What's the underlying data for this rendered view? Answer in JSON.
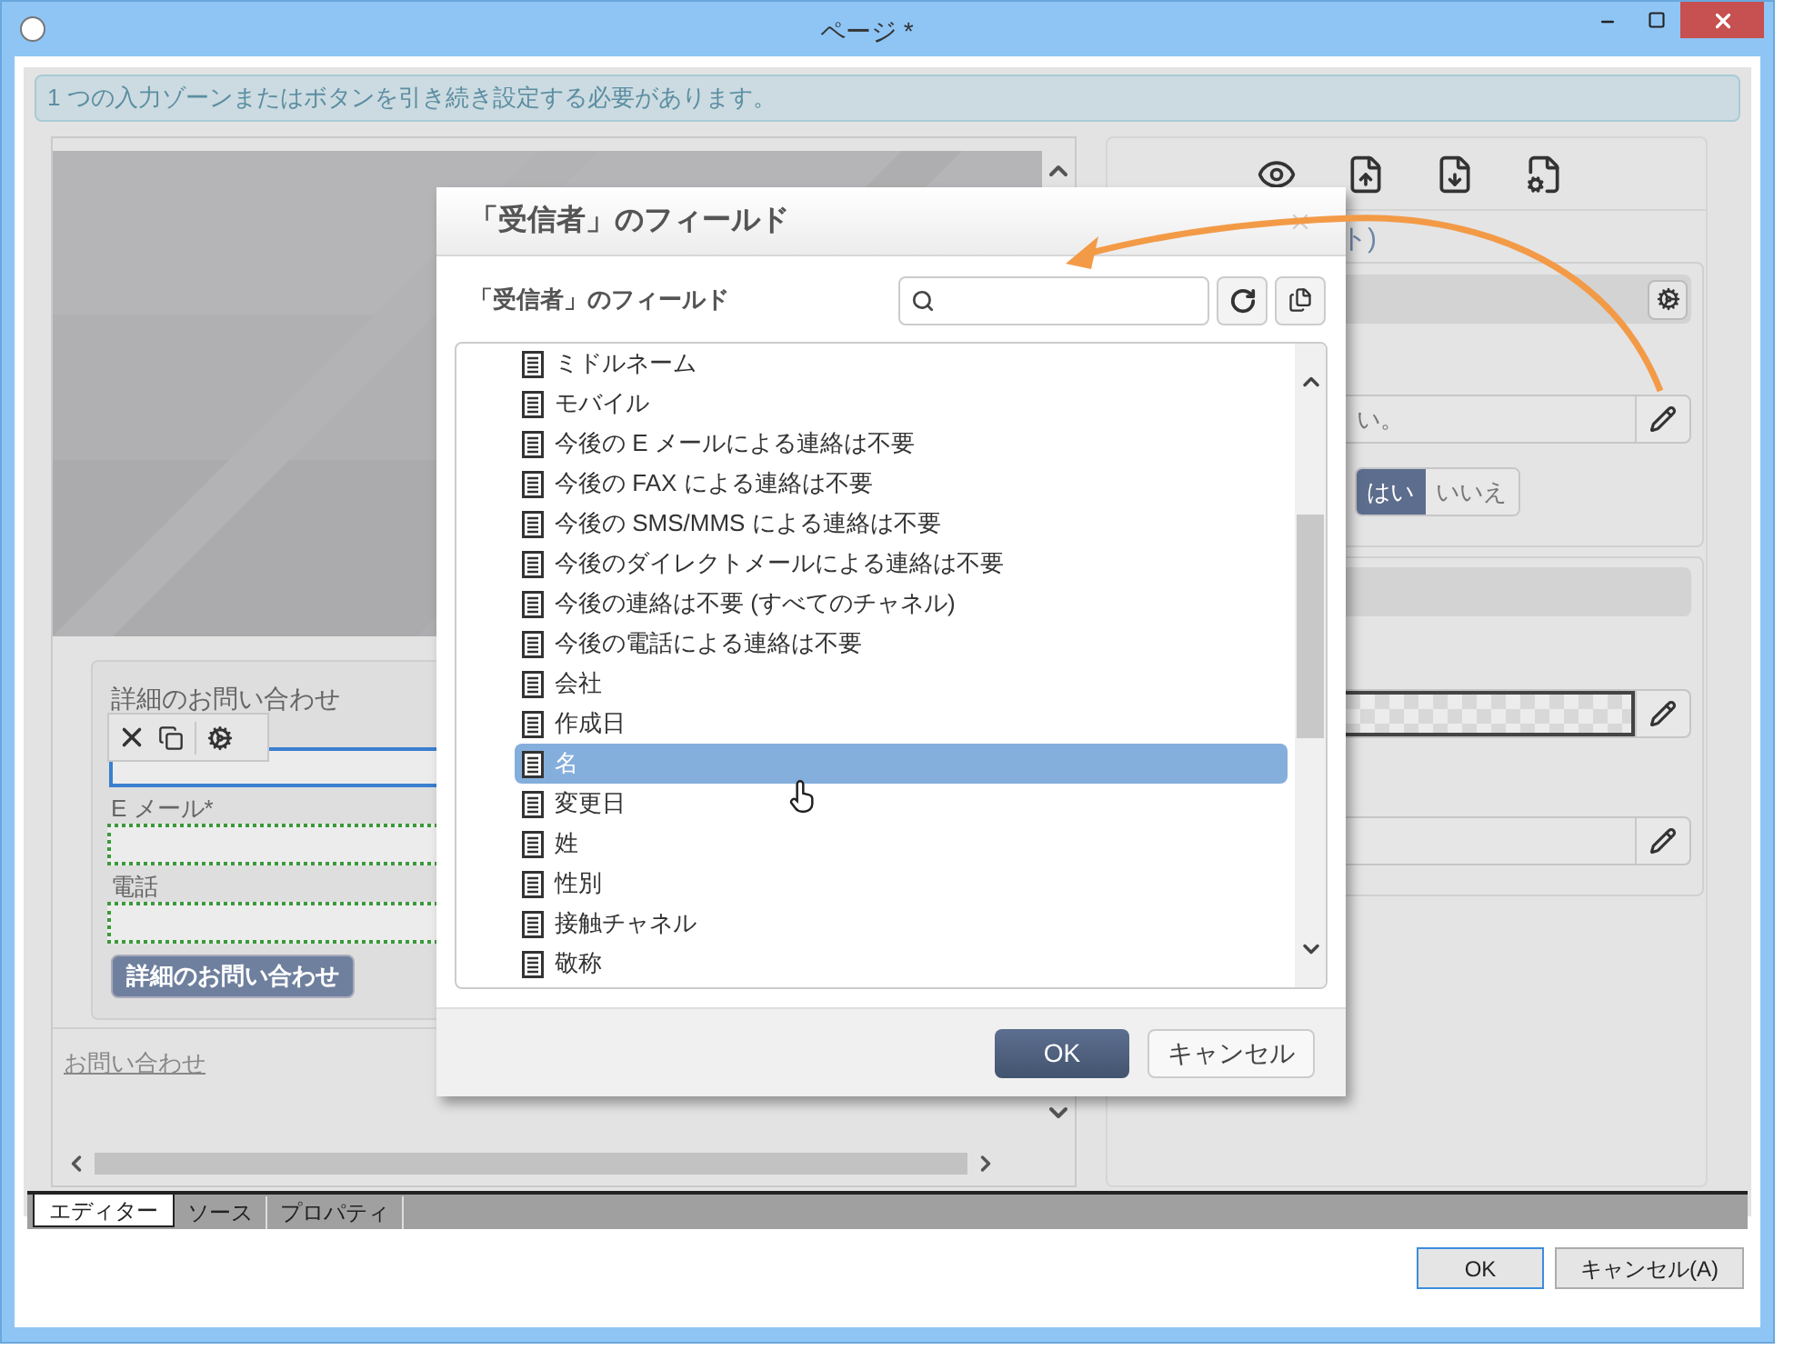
{
  "window": {
    "title": "ページ *"
  },
  "notice": "1 つの入力ゾーンまたはボタンを引き続き設定する必要があります。",
  "form": {
    "title": "詳細のお問い合わせ",
    "fields": [
      {
        "kind": "focused"
      },
      {
        "kind": "dotted",
        "label": "E メール*"
      },
      {
        "kind": "dotted",
        "label": "電話"
      }
    ],
    "submit": "詳細のお問い合わせ",
    "link": "お問い合わせ"
  },
  "right_panel": {
    "heading_fragment": "ト)",
    "field_fragment": "い。",
    "toggle": [
      {
        "label": "はい",
        "selected": true
      },
      {
        "label": "いいえ",
        "selected": false
      }
    ]
  },
  "bottom_tabs": [
    {
      "label": "エディター",
      "selected": true
    },
    {
      "label": "ソース",
      "selected": false
    },
    {
      "label": "プロパティ",
      "selected": false
    }
  ],
  "buttons": [
    {
      "label": "OK",
      "focused": true
    },
    {
      "label": "キャンセル(A)",
      "focused": false
    }
  ],
  "dialog": {
    "title": "「受信者」のフィールド",
    "label": "「受信者」のフィールド",
    "items": [
      {
        "label": "ミドルネーム",
        "selected": false
      },
      {
        "label": "モバイル",
        "selected": false
      },
      {
        "label": "今後の E メールによる連絡は不要",
        "selected": false
      },
      {
        "label": "今後の FAX による連絡は不要",
        "selected": false
      },
      {
        "label": "今後の SMS/MMS による連絡は不要",
        "selected": false
      },
      {
        "label": "今後のダイレクトメールによる連絡は不要",
        "selected": false
      },
      {
        "label": "今後の連絡は不要 (すべてのチャネル)",
        "selected": false
      },
      {
        "label": "今後の電話による連絡は不要",
        "selected": false
      },
      {
        "label": "会社",
        "selected": false
      },
      {
        "label": "作成日",
        "selected": false
      },
      {
        "label": "名",
        "selected": true
      },
      {
        "label": "変更日",
        "selected": false
      },
      {
        "label": "姓",
        "selected": false
      },
      {
        "label": "性別",
        "selected": false
      },
      {
        "label": "接触チャネル",
        "selected": false
      },
      {
        "label": "敬称",
        "selected": false
      }
    ],
    "buttons": [
      {
        "label": "OK",
        "kind": "primary"
      },
      {
        "label": "キャンセル",
        "kind": "secondary"
      }
    ]
  }
}
